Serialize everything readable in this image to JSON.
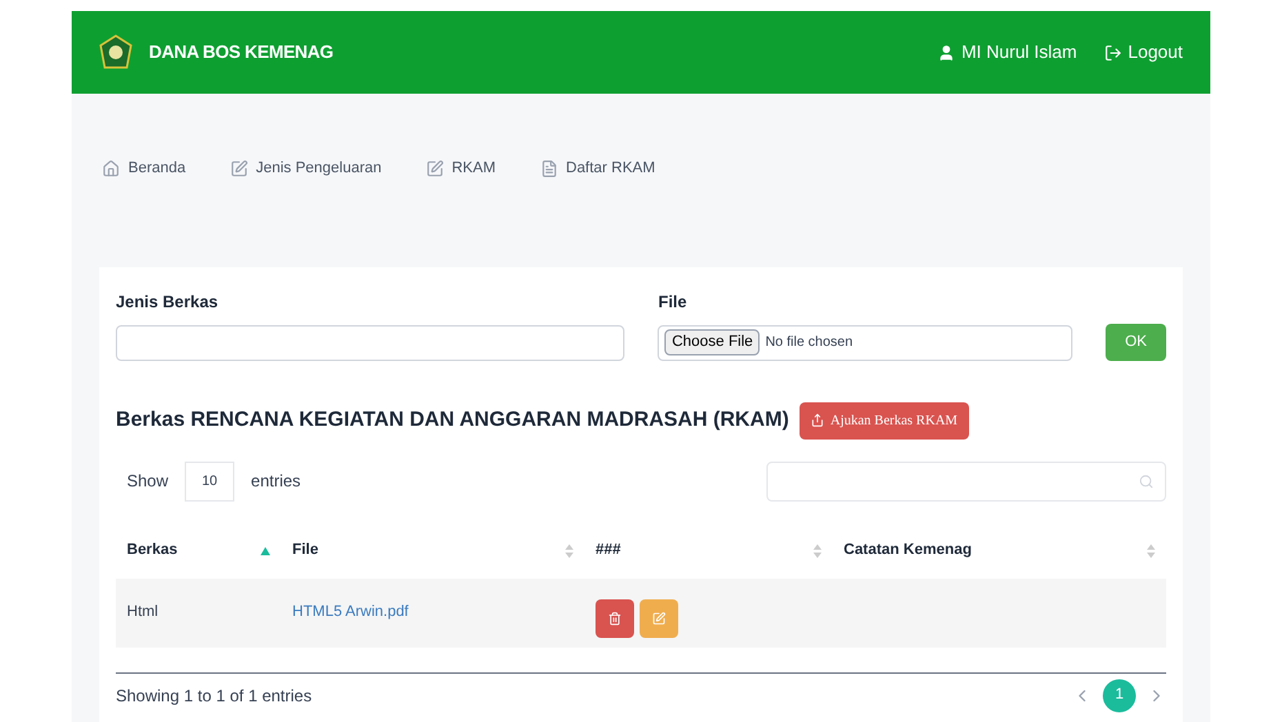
{
  "header": {
    "brand": "DANA BOS KEMENAG",
    "user": "MI Nurul Islam",
    "logout": "Logout"
  },
  "nav": [
    {
      "label": "Beranda",
      "kind": "home"
    },
    {
      "label": "Jenis Pengeluaran",
      "kind": "edit"
    },
    {
      "label": "RKAM",
      "kind": "edit"
    },
    {
      "label": "Daftar RKAM",
      "kind": "document"
    }
  ],
  "form": {
    "jenis_label": "Jenis Berkas",
    "file_label": "File",
    "choose": "Choose File",
    "no_file": "No file chosen",
    "ok": "OK"
  },
  "section": {
    "title": "Berkas RENCANA KEGIATAN DAN ANGGARAN MADRASAH (RKAM)",
    "submit": "Ajukan Berkas RKAM"
  },
  "table": {
    "show": "Show",
    "page_size": "10",
    "entries": "entries",
    "columns": [
      {
        "label": "Berkas",
        "sorted": true
      },
      {
        "label": "File",
        "sorted": false
      },
      {
        "label": "###",
        "sorted": false
      },
      {
        "label": "Catatan Kemenag",
        "sorted": false
      }
    ],
    "rows": [
      {
        "berkas": "Html",
        "file": "HTML5 Arwin.pdf"
      }
    ],
    "info": "Showing 1 to 1 of 1 entries",
    "pages": [
      {
        "label": "1",
        "selected": true
      }
    ]
  }
}
